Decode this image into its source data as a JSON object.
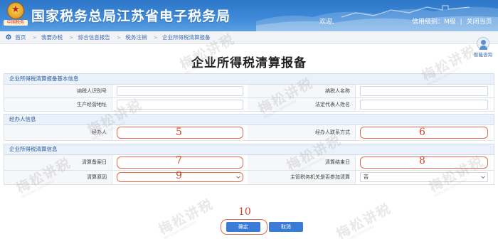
{
  "header": {
    "emblem_text": "中国税务",
    "title": "国家税务总局江苏省电子税务局",
    "welcome": "欢迎,",
    "credit_level": "信用级别：M级",
    "separator": "|",
    "logout": "关闭当页"
  },
  "breadcrumb": {
    "items": [
      "首页",
      "我要办税",
      "综合信息报告",
      "税务注销",
      "企业所得税清算报备"
    ]
  },
  "consult": {
    "label": "智能咨询"
  },
  "form": {
    "title": "企业所得税清算报备",
    "sections": [
      {
        "heading": "企业所得税清算报备基本信息",
        "rows": [
          {
            "left_label": "纳税人识别号",
            "left_value": "",
            "right_label": "纳税人名称",
            "right_value": ""
          },
          {
            "left_label": "生产经营地址",
            "left_value": "",
            "right_label": "法定代表人姓名",
            "right_value": ""
          }
        ]
      },
      {
        "heading": "经办人信息",
        "rows": [
          {
            "left_label": "经办人",
            "left_value": "",
            "left_step": "5",
            "right_label": "经办人联系方式",
            "right_value": "",
            "right_step": "6"
          }
        ]
      },
      {
        "heading": "企业所得税清算信息",
        "rows": [
          {
            "left_label": "清算备案日",
            "left_value": "",
            "left_step": "7",
            "right_label": "清算结束日",
            "right_value": "",
            "right_step": "8"
          },
          {
            "left_label": "清算原因",
            "left_value": "",
            "left_step": "9",
            "right_label": "主管税务机关是否参加清算",
            "right_value": "否"
          }
        ]
      }
    ]
  },
  "actions": {
    "step": "10",
    "confirm": "确定",
    "cancel": "取消"
  },
  "watermark": {
    "text": "梅松讲税",
    "sub": "MEISONG JIANGSHUI"
  },
  "colors": {
    "header_blue": "#2d76c8",
    "button_blue": "#3a7bd5",
    "annotation_red": "#d0442a",
    "section_bg": "#eaf1fa"
  }
}
